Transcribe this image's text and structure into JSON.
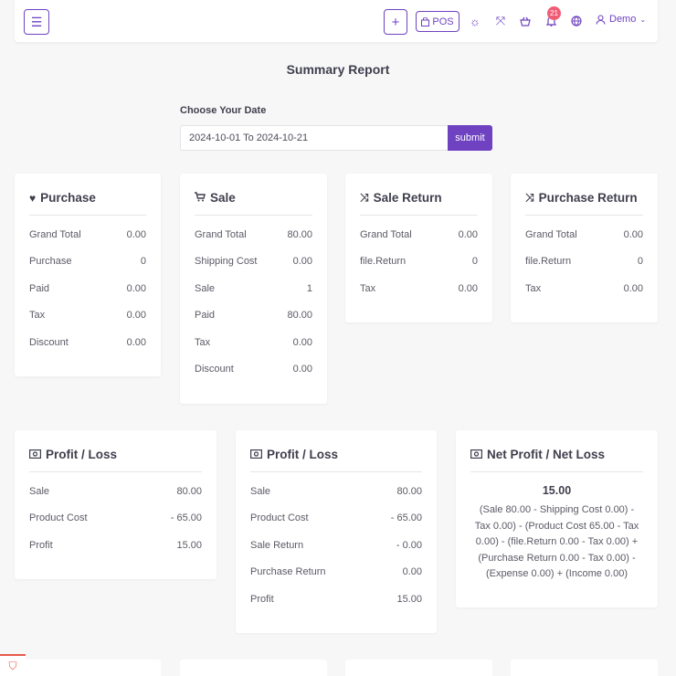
{
  "topbar": {
    "menu_icon": "hamburger-icon",
    "plus_label": "+",
    "pos_label": "POS",
    "notifications_count": "21",
    "user_label": "Demo"
  },
  "page": {
    "title": "Summary Report",
    "date_label": "Choose Your Date",
    "date_value": "2024-10-01 To 2024-10-21",
    "submit_label": "submit"
  },
  "cards": {
    "purchase": {
      "title": "Purchase",
      "rows": [
        {
          "label": "Grand Total",
          "value": "0.00"
        },
        {
          "label": "Purchase",
          "value": "0"
        },
        {
          "label": "Paid",
          "value": "0.00"
        },
        {
          "label": "Tax",
          "value": "0.00"
        },
        {
          "label": "Discount",
          "value": "0.00"
        }
      ]
    },
    "sale": {
      "title": "Sale",
      "rows": [
        {
          "label": "Grand Total",
          "value": "80.00"
        },
        {
          "label": "Shipping Cost",
          "value": "0.00"
        },
        {
          "label": "Sale",
          "value": "1"
        },
        {
          "label": "Paid",
          "value": "80.00"
        },
        {
          "label": "Tax",
          "value": "0.00"
        },
        {
          "label": "Discount",
          "value": "0.00"
        }
      ]
    },
    "sale_return": {
      "title": "Sale Return",
      "rows": [
        {
          "label": "Grand Total",
          "value": "0.00"
        },
        {
          "label": "file.Return",
          "value": "0"
        },
        {
          "label": "Tax",
          "value": "0.00"
        }
      ]
    },
    "purchase_return": {
      "title": "Purchase Return",
      "rows": [
        {
          "label": "Grand Total",
          "value": "0.00"
        },
        {
          "label": "file.Return",
          "value": "0"
        },
        {
          "label": "Tax",
          "value": "0.00"
        }
      ]
    },
    "profit1": {
      "title": "Profit / Loss",
      "rows": [
        {
          "label": "Sale",
          "value": "80.00"
        },
        {
          "label": "Product Cost",
          "value": "- 65.00"
        },
        {
          "label": "Profit",
          "value": "15.00"
        }
      ]
    },
    "profit2": {
      "title": "Profit / Loss",
      "rows": [
        {
          "label": "Sale",
          "value": "80.00"
        },
        {
          "label": "Product Cost",
          "value": "- 65.00"
        },
        {
          "label": "Sale Return",
          "value": "- 0.00"
        },
        {
          "label": "Purchase Return",
          "value": "0.00"
        },
        {
          "label": "Profit",
          "value": "15.00"
        }
      ]
    },
    "net": {
      "title": "Net Profit / Net Loss",
      "value": "15.00",
      "formula": "(Sale 80.00 - Shipping Cost 0.00) - Tax 0.00) - (Product Cost 65.00 - Tax 0.00) - (file.Return 0.00 - Tax 0.00) + (Purchase Return 0.00 - Tax 0.00) - (Expense 0.00) + (Income 0.00)"
    }
  },
  "colors": {
    "accent": "#6f42c1",
    "badge": "#f15c75"
  }
}
